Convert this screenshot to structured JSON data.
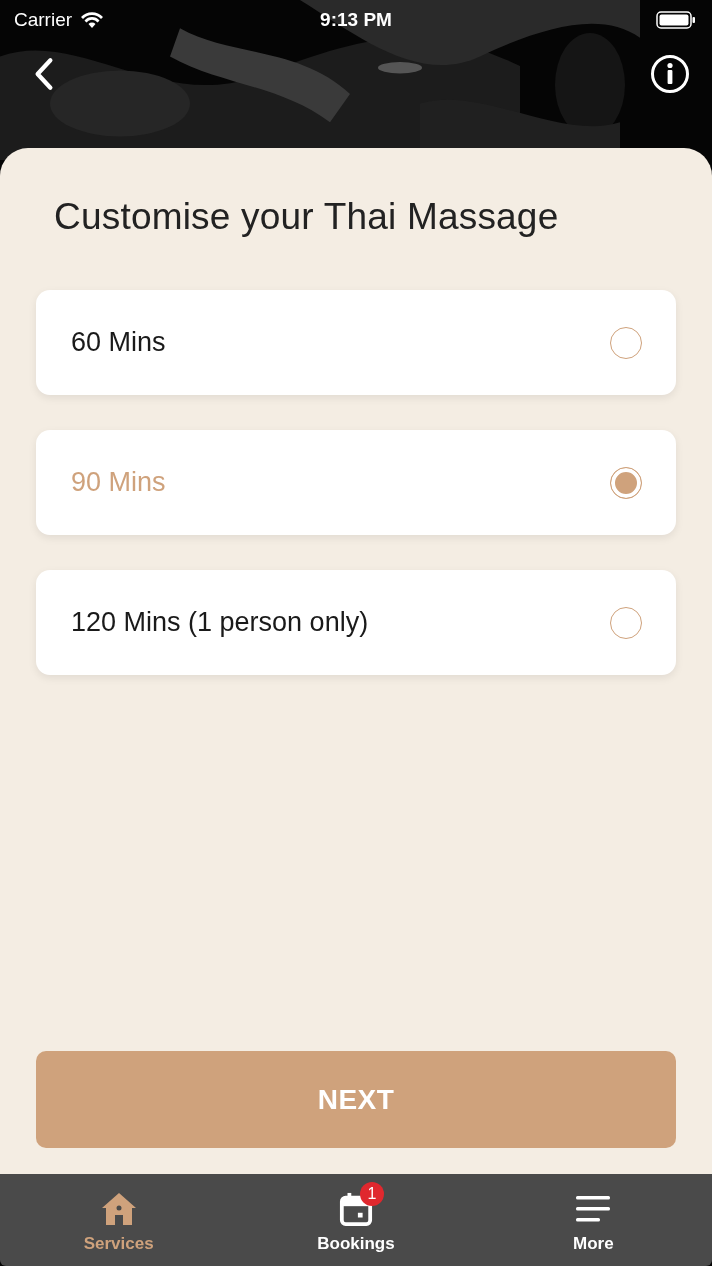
{
  "status_bar": {
    "carrier": "Carrier",
    "time": "9:13 PM"
  },
  "title": "Customise your Thai Massage",
  "options": [
    {
      "label": "60 Mins",
      "selected": false
    },
    {
      "label": "90 Mins",
      "selected": true
    },
    {
      "label": "120 Mins (1 person only)",
      "selected": false
    }
  ],
  "next_button": "NEXT",
  "tab_bar": [
    {
      "label": "Services",
      "selected": true,
      "kind": "home"
    },
    {
      "label": "Bookings",
      "selected": false,
      "kind": "calendar",
      "badge": "1"
    },
    {
      "label": "More",
      "selected": false,
      "kind": "menu"
    }
  ]
}
